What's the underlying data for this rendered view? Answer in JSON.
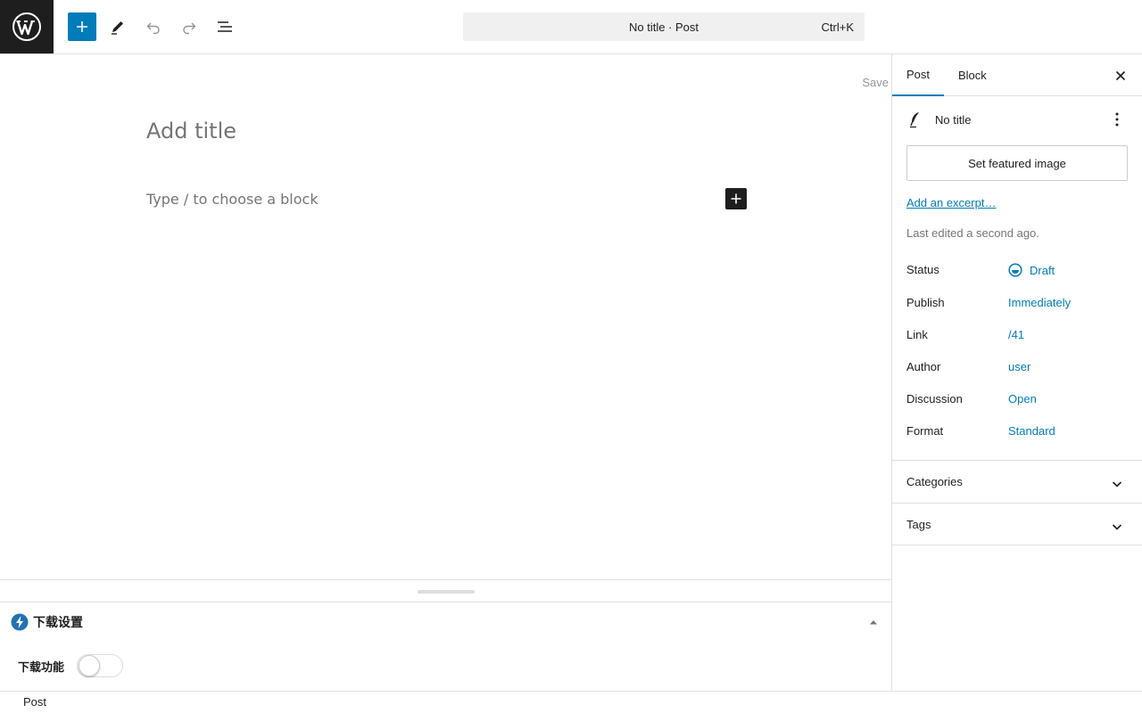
{
  "topbar": {
    "command_title": "No title · Post",
    "command_shortcut": "Ctrl+K"
  },
  "editor": {
    "save_label": "Save",
    "title_placeholder": "Add title",
    "block_placeholder": "Type / to choose a block"
  },
  "metabox": {
    "title": "下载设置",
    "field_label": "下载功能",
    "toggle_on": false
  },
  "footer": {
    "breadcrumb": "Post"
  },
  "sidebar": {
    "tabs": [
      {
        "label": "Post",
        "active": true
      },
      {
        "label": "Block",
        "active": false
      }
    ],
    "post_title": "No title",
    "featured_image_label": "Set featured image",
    "excerpt_link": "Add an excerpt…",
    "last_edited": "Last edited a second ago.",
    "meta": [
      {
        "label": "Status",
        "value": "Draft"
      },
      {
        "label": "Publish",
        "value": "Immediately"
      },
      {
        "label": "Link",
        "value": "/41"
      },
      {
        "label": "Author",
        "value": "user"
      },
      {
        "label": "Discussion",
        "value": "Open"
      },
      {
        "label": "Format",
        "value": "Standard"
      }
    ],
    "panels": [
      {
        "label": "Categories"
      },
      {
        "label": "Tags"
      }
    ]
  },
  "colors": {
    "accent": "#007cba",
    "dark": "#1e1e1e",
    "muted": "#757575",
    "border": "#e0e0e0"
  }
}
